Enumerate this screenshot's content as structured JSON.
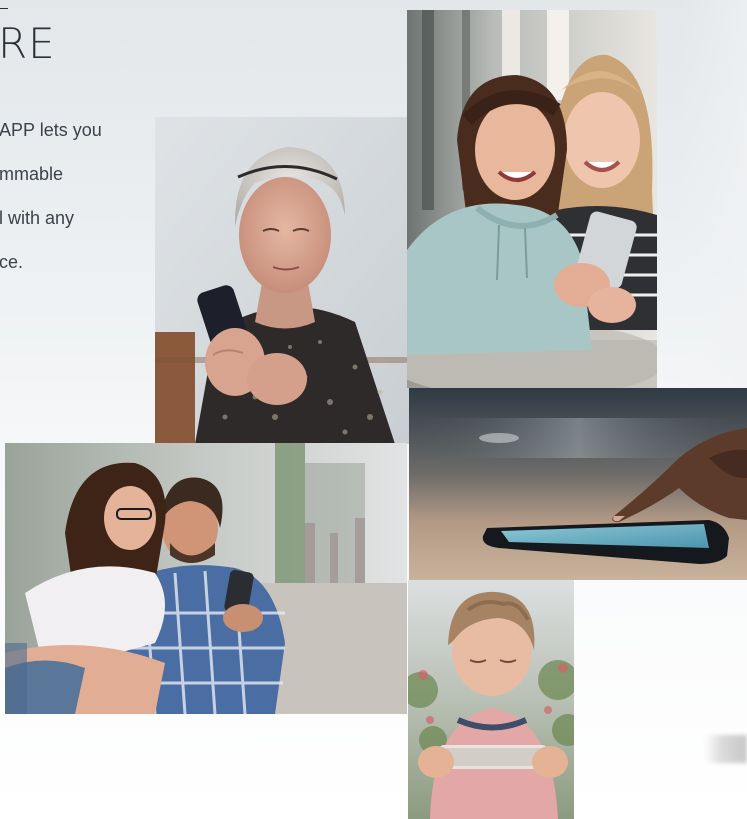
{
  "heading": {
    "text": "RE"
  },
  "body_text": {
    "lines": [
      "APP lets you",
      "mmable",
      "l with any",
      "ce."
    ]
  },
  "photos": [
    {
      "name": "photo-elderly-woman",
      "subject": "elderly woman using smartphone"
    },
    {
      "name": "photo-two-girls",
      "subject": "two girls laughing at a phone"
    },
    {
      "name": "photo-couple",
      "subject": "couple looking at a phone on the street"
    },
    {
      "name": "photo-hand-phone",
      "subject": "finger touching a phone on a table"
    },
    {
      "name": "photo-boy",
      "subject": "boy playing on a phone"
    }
  ],
  "colors": {
    "background_top": "#e3e7ea",
    "background_bottom": "#ffffff",
    "text": "#2c3138"
  }
}
